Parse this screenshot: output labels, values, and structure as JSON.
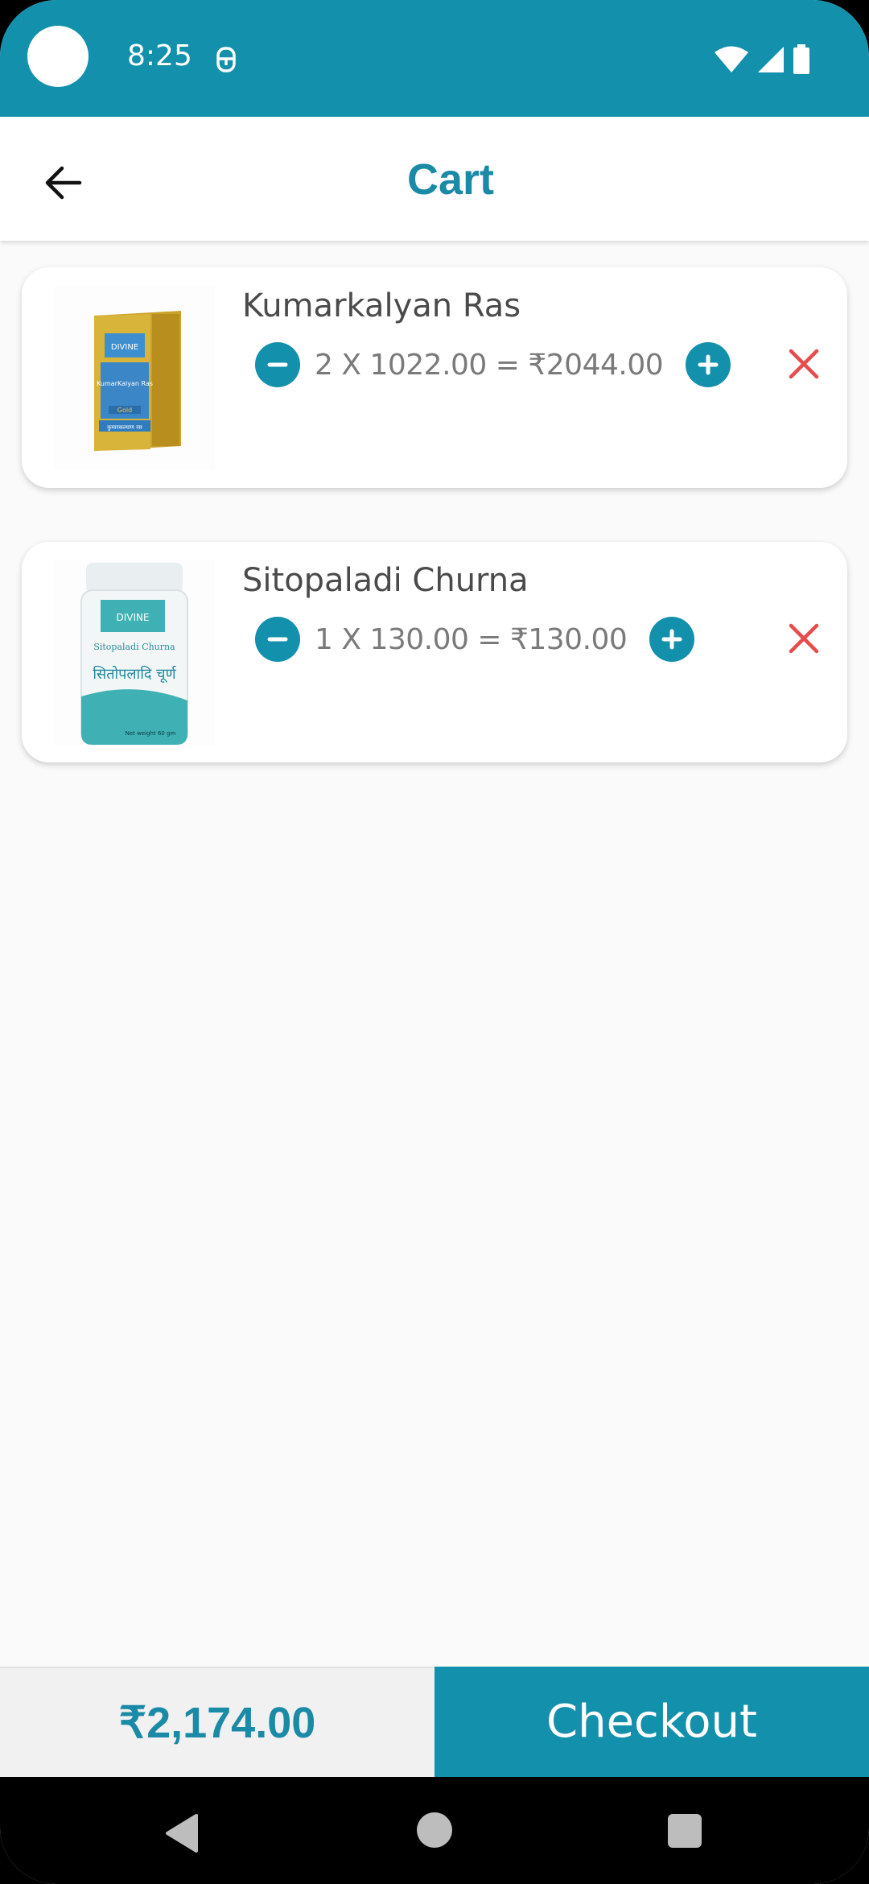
{
  "status_bar": {
    "time": "8:25",
    "icons": [
      "notification-icon",
      "wifi-icon",
      "signal-icon",
      "battery-icon"
    ]
  },
  "header": {
    "title": "Cart",
    "back_icon": "arrow-left-icon"
  },
  "cart": {
    "items": [
      {
        "name": "Kumarkalyan Ras",
        "quantity": "2",
        "line_calc": "2 X 1022.00  =  ₹2044.00",
        "thumb_label": "KumarKalyan Ras",
        "thumb_brand": "DIVINE",
        "thumb_hindi": "कुमारकल्याण रस",
        "thumb_gold": "Gold"
      },
      {
        "name": "Sitopaladi Churna",
        "quantity": "1",
        "line_calc": "1 X 130.00  =  ₹130.00",
        "thumb_label": "Sitopaladi Churna",
        "thumb_brand": "DIVINE",
        "thumb_hindi": "सितोपलादि चूर्ण",
        "thumb_weight": "Net weight 60 gm"
      }
    ]
  },
  "footer": {
    "total": "₹2,174.00",
    "checkout_label": "Checkout"
  },
  "colors": {
    "primary": "#1390ab",
    "title": "#1a8aa6",
    "remove": "#e84b4b"
  }
}
